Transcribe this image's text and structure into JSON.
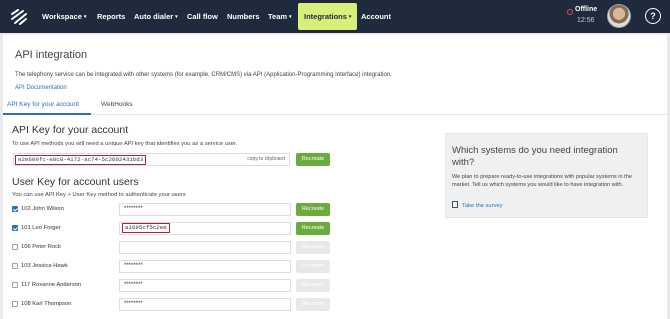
{
  "nav": {
    "items": [
      {
        "label": "Workspace",
        "caret": "▾"
      },
      {
        "label": "Reports",
        "caret": ""
      },
      {
        "label": "Auto dialer",
        "caret": "▾"
      },
      {
        "label": "Call flow",
        "caret": ""
      },
      {
        "label": "Numbers",
        "caret": ""
      },
      {
        "label": "Team",
        "caret": "▾"
      },
      {
        "label": "Integrations",
        "caret": "▾"
      },
      {
        "label": "Account",
        "caret": ""
      }
    ],
    "status_label": "Offline",
    "status_time": "12:56",
    "help_glyph": "?"
  },
  "page": {
    "title": "API integration",
    "description": "The telephony service can be integrated with other systems (for example, CRM/CMS) via API (Application-Programming Interface) integration.",
    "doc_link": "API Documentation",
    "tabs": [
      "API Key for your account",
      "WebHooks"
    ]
  },
  "account_key": {
    "heading": "API Key for your account",
    "hint": "To use API methods you will need a unique API key that identifies you as a service user.",
    "value": "e2e609fc-e8c8-4172-ac74-5c2602431bd3",
    "copy_label": "copy to clipboard",
    "recreate_label": "Recreate"
  },
  "user_keys": {
    "heading": "User Key for account users",
    "hint": "You can use API Key + User Key method to authenticate your users",
    "users": [
      {
        "name": "102 John Wilson",
        "key": "********",
        "checked": true,
        "enabled": true,
        "highlight": false
      },
      {
        "name": "101 Leo Forger",
        "key": "a1695cf5c2ee",
        "checked": true,
        "enabled": true,
        "highlight": true
      },
      {
        "name": "106 Peter Rock",
        "key": "",
        "checked": false,
        "enabled": false,
        "highlight": false
      },
      {
        "name": "103 Jessica Hawk",
        "key": "********",
        "checked": false,
        "enabled": false,
        "highlight": false
      },
      {
        "name": "117 Roxanne Anderson",
        "key": "********",
        "checked": false,
        "enabled": false,
        "highlight": false
      },
      {
        "name": "108 Karl Thompson",
        "key": "********",
        "checked": false,
        "enabled": false,
        "highlight": false
      }
    ],
    "recreate_label": "Recreate"
  },
  "sidebar": {
    "title": "Which systems do you need integration with?",
    "text": "We plan to prepare ready-to-use integrations with popular systems in the market. Tell us which systems you would like to have integration with.",
    "survey_link": "Take the survey"
  },
  "colors": {
    "topbar": "#1f2a3c",
    "active_nav": "#d9ef7c",
    "accent": "#2a6fbb",
    "button": "#6bab3d",
    "offline": "#e6474c",
    "highlight_border": "#a8262d"
  }
}
